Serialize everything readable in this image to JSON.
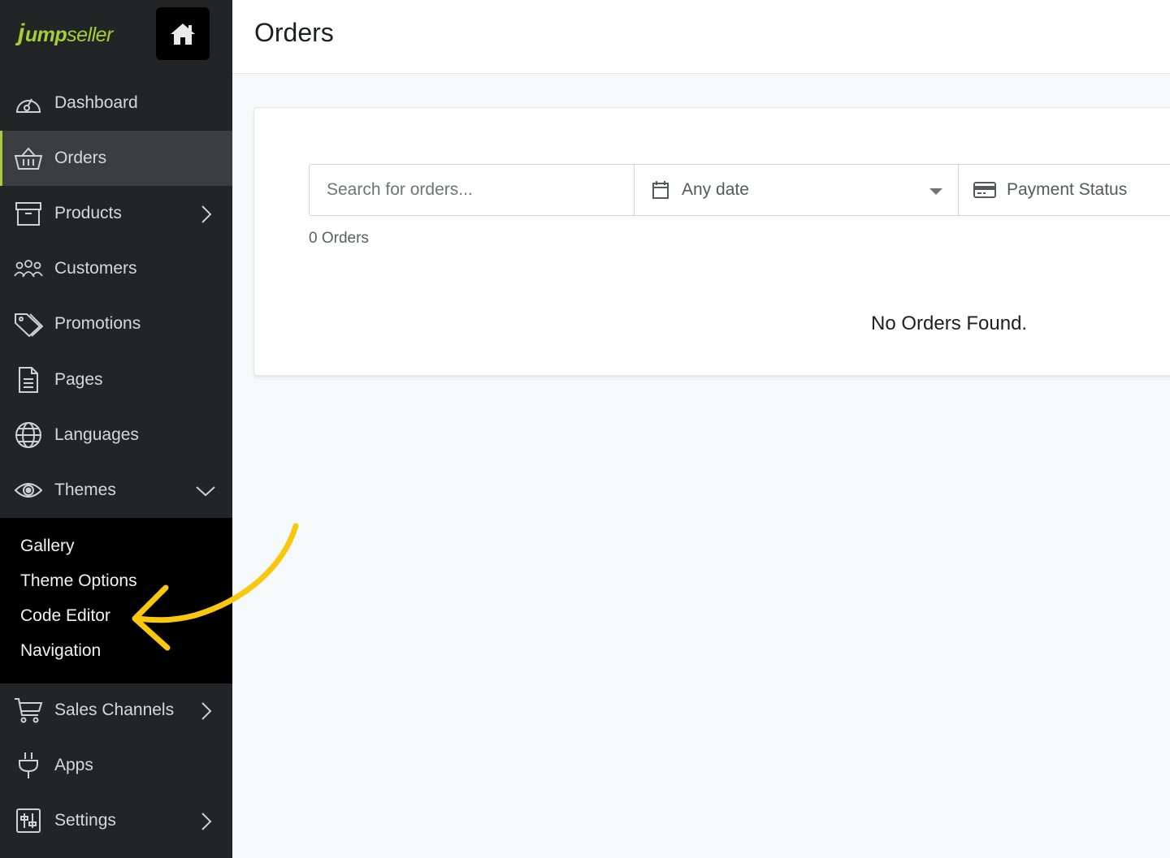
{
  "brand": {
    "logo_j": "j",
    "logo_ump": "ump",
    "logo_seller": "seller"
  },
  "colors": {
    "sidebar": "#222426",
    "accent": "#a6ce39",
    "annotation": "#f9c80e"
  },
  "nav": {
    "dashboard": "Dashboard",
    "orders": "Orders",
    "products": "Products",
    "customers": "Customers",
    "promotions": "Promotions",
    "pages": "Pages",
    "languages": "Languages",
    "themes": "Themes",
    "sales_channels": "Sales Channels",
    "apps": "Apps",
    "settings": "Settings"
  },
  "themes_submenu": {
    "gallery": "Gallery",
    "theme_options": "Theme Options",
    "code_editor": "Code Editor",
    "navigation": "Navigation"
  },
  "main": {
    "title": "Orders",
    "search_placeholder": "Search for orders...",
    "date_filter": "Any date",
    "payment_filter": "Payment Status",
    "count": "0 Orders",
    "empty": "No Orders Found."
  }
}
